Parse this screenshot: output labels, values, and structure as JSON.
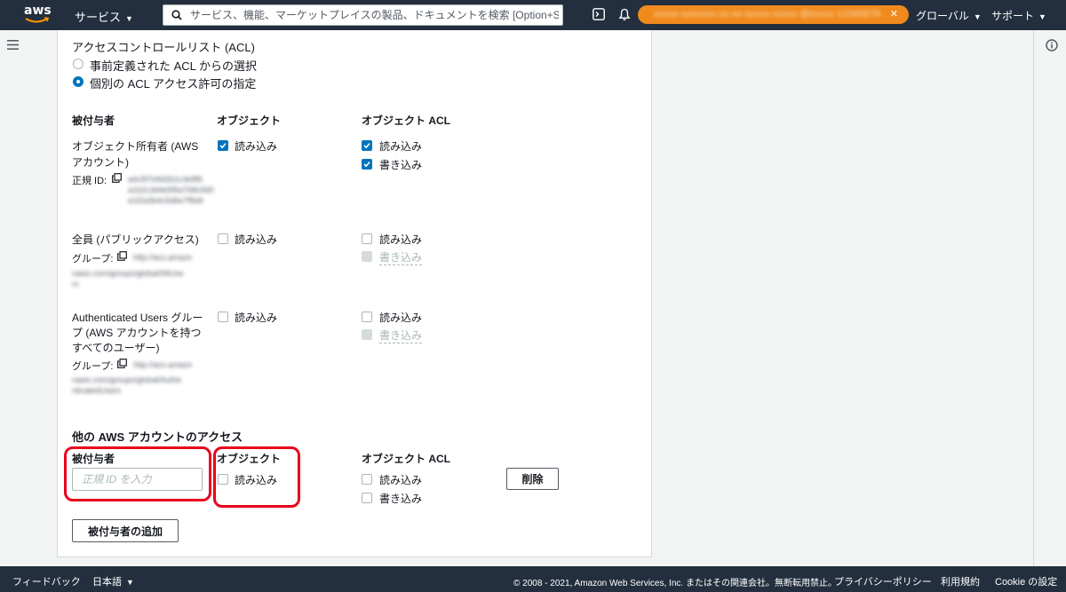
{
  "header": {
    "logo_text": "aws",
    "services_label": "サービス",
    "search_placeholder": "サービス、機能、マーケットプレイスの製品、ドキュメントを検索 [Option+S]",
    "account_text": "xxxxx-xxxxxxx-xx-xx-xxxxx-xxxxx @xxxxx  12345678",
    "region_label": "グローバル",
    "support_label": "サポート"
  },
  "acl": {
    "title": "アクセスコントロールリスト (ACL)",
    "radio_predefined": "事前定義された ACL からの選択",
    "radio_individual": "個別の ACL アクセス許可の指定",
    "selected_option": "個別の ACL アクセス許可の指定",
    "col_grantee": "被付与者",
    "col_object": "オブジェクト",
    "col_object_acl": "オブジェクト ACL",
    "rows": [
      {
        "grantee_lines": [
          "オブジェクト所有者 (AWS",
          "アカウント)"
        ],
        "id_label": "正規 ID:",
        "object_read": "読み込み",
        "object_read_checked": true,
        "acl_read": "読み込み",
        "acl_read_checked": true,
        "acl_write": "書き込み",
        "acl_write_checked": true,
        "acl_write_disabled": false
      },
      {
        "grantee_lines": [
          "全員 (パブリックアクセス)"
        ],
        "id_label": "グループ:",
        "object_read": "読み込み",
        "object_read_checked": false,
        "acl_read": "読み込み",
        "acl_read_checked": false,
        "acl_write": "書き込み",
        "acl_write_checked": false,
        "acl_write_disabled": true
      },
      {
        "grantee_lines": [
          "Authenticated Users グルー",
          "プ (AWS アカウントを持つ",
          "すべてのユーザー)"
        ],
        "id_label": "グループ:",
        "object_read": "読み込み",
        "object_read_checked": false,
        "acl_read": "読み込み",
        "acl_read_checked": false,
        "acl_write": "書き込み",
        "acl_write_checked": false,
        "acl_write_disabled": true
      }
    ]
  },
  "other_accounts": {
    "title": "他の AWS アカウントのアクセス",
    "col_grantee": "被付与者",
    "col_object": "オブジェクト",
    "col_object_acl": "オブジェクト ACL",
    "id_placeholder": "正規 ID を入力",
    "object_read": "読み込み",
    "acl_read": "読み込み",
    "acl_write": "書き込み",
    "delete_button": "削除",
    "add_grantee_button": "被付与者の追加"
  },
  "footer": {
    "feedback": "フィードバック",
    "language": "日本語",
    "copyright": "© 2008 - 2021, Amazon Web Services, Inc. またはその関連会社。無断転用禁止。",
    "privacy": "プライバシーポリシー",
    "terms": "利用規約",
    "cookie": "Cookie の設定"
  },
  "colors": {
    "nav_bg": "#232f3e",
    "accent_blue": "#0073bb",
    "account_orange": "#f08a1c",
    "annotation_red": "#e8001c"
  }
}
